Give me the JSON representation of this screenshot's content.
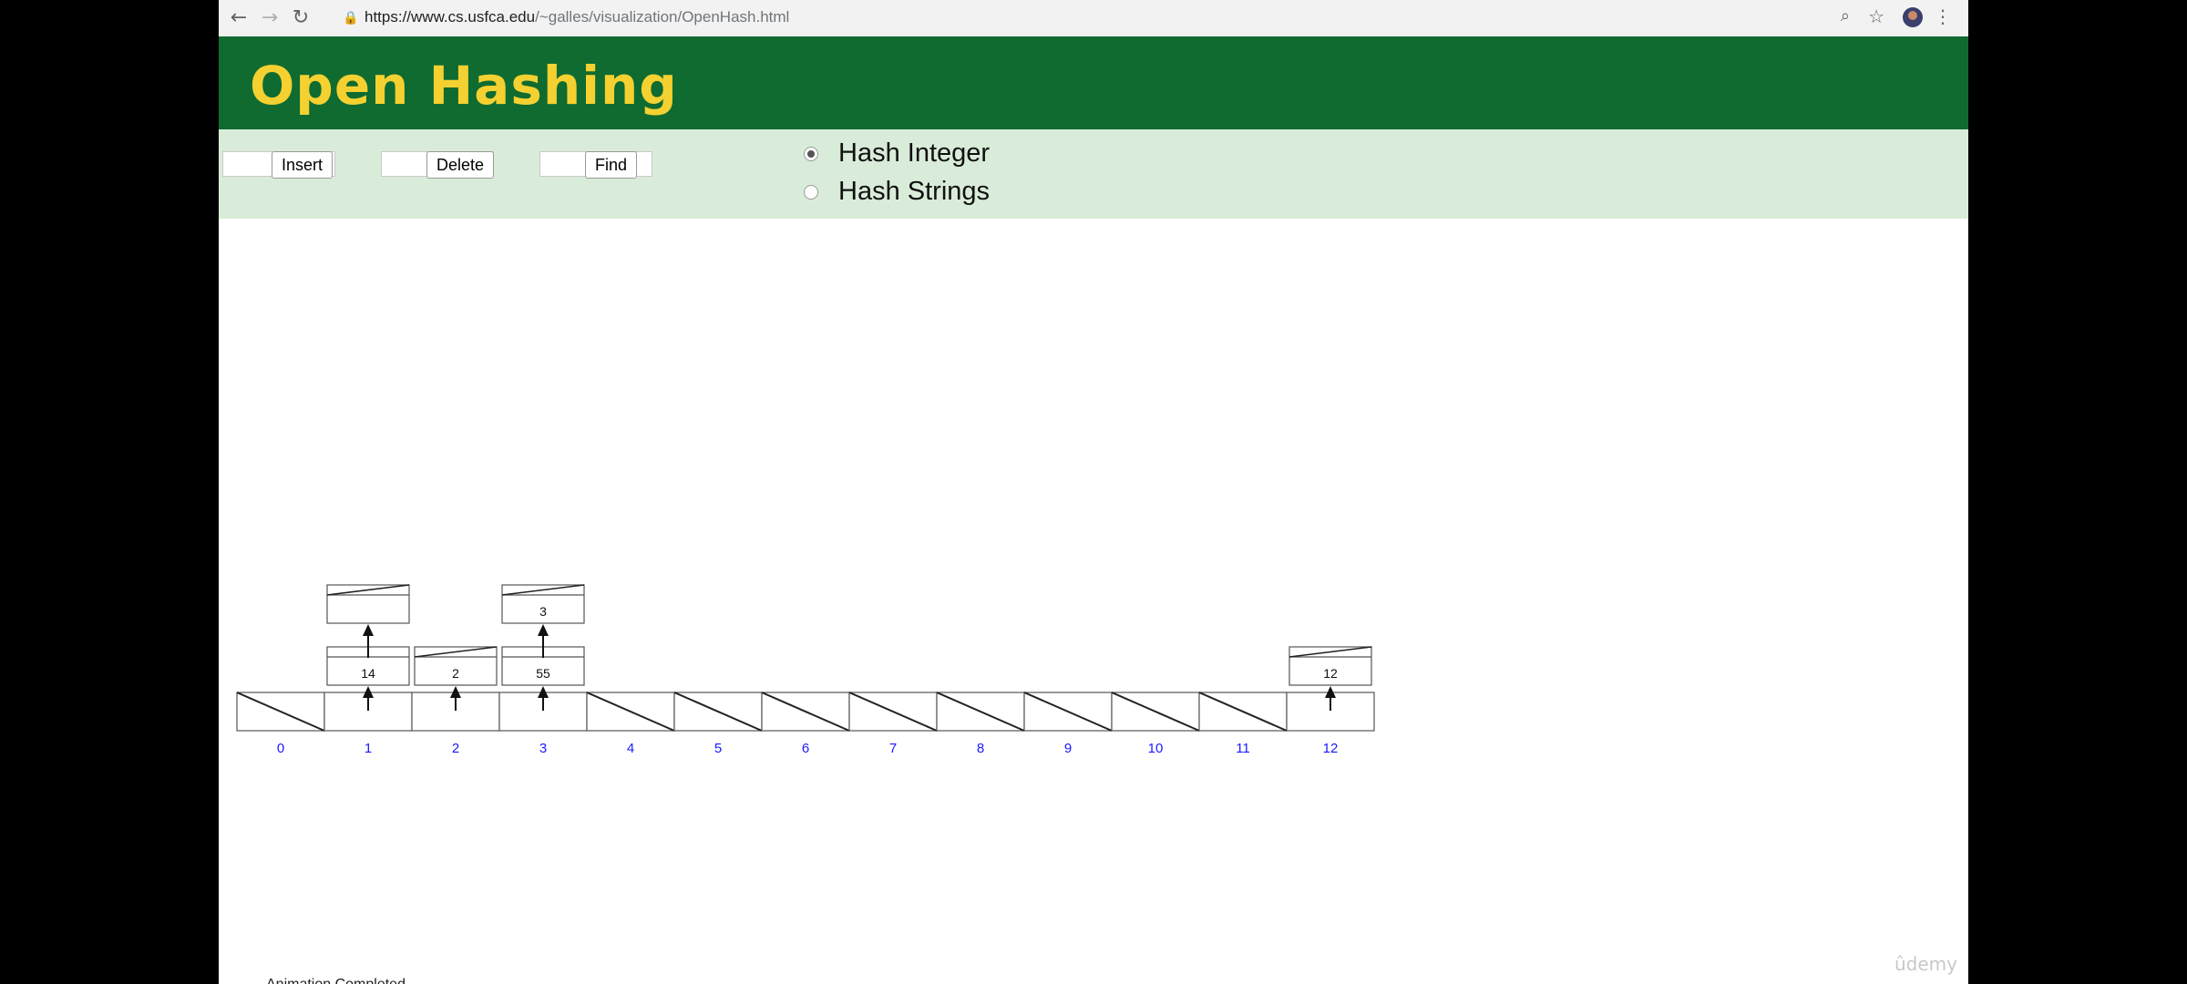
{
  "browser": {
    "url_host": "https://www.cs.usfca.edu",
    "url_path": "/~galles/visualization/OpenHash.html",
    "back_glyph": "←",
    "forward_glyph": "→",
    "reload_glyph": "↻",
    "lock_glyph": "🔒",
    "zoom_glyph": "⌕",
    "star_glyph": "☆",
    "menu_glyph": "⋮"
  },
  "page": {
    "title": "Open Hashing"
  },
  "controls": {
    "insert_value": "",
    "insert_label": "Insert",
    "delete_value": "",
    "delete_label": "Delete",
    "find_value": "",
    "find_label": "Find",
    "options": [
      {
        "label": "Hash Integer",
        "selected": true
      },
      {
        "label": "Hash Strings",
        "selected": false
      }
    ]
  },
  "hash_table": {
    "indices": [
      "0",
      "1",
      "2",
      "3",
      "4",
      "5",
      "6",
      "7",
      "8",
      "9",
      "10",
      "11",
      "12"
    ],
    "buckets": [
      [],
      [
        "14",
        ""
      ],
      [
        "2"
      ],
      [
        "55",
        "3"
      ],
      [],
      [],
      [],
      [],
      [],
      [],
      [],
      [],
      [
        "12"
      ]
    ],
    "index_color": "#1a1aff"
  },
  "status": "Animation Completed",
  "watermark": "ûdemy"
}
